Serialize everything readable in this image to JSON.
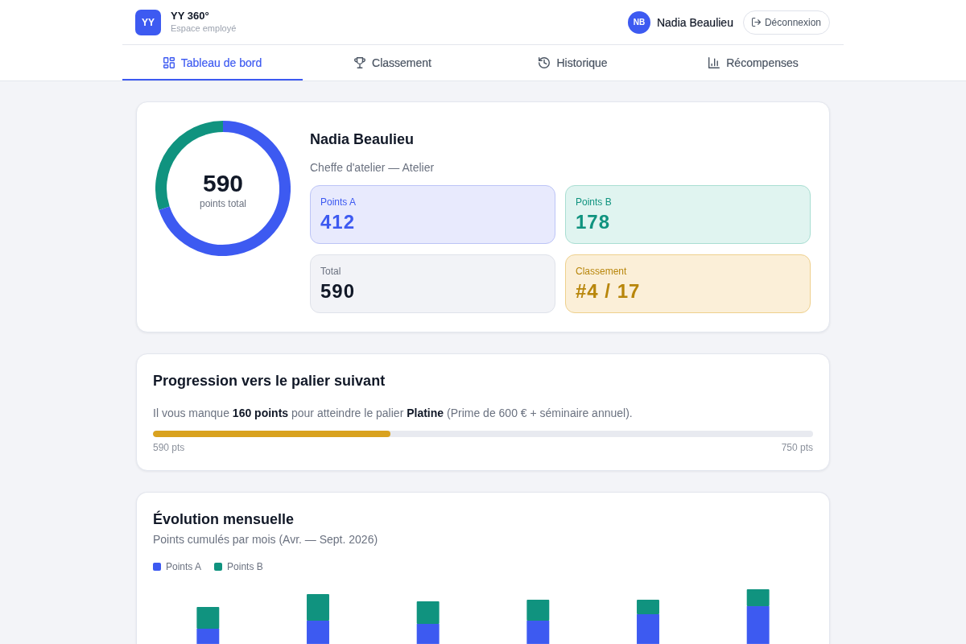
{
  "header": {
    "logo_text": "YY",
    "app_name": "YY 360°",
    "app_subtitle": "Espace employé",
    "user": {
      "initials": "NB",
      "name": "Nadia Beaulieu"
    },
    "logout_button": "Déconnexion"
  },
  "tabs": [
    {
      "label": "Tableau de bord",
      "selected": true
    },
    {
      "label": "Classement",
      "selected": false
    },
    {
      "label": "Historique",
      "selected": false
    },
    {
      "label": "Récompenses",
      "selected": false
    }
  ],
  "profile": {
    "donut": {
      "value": "590",
      "caption": "points total"
    },
    "name": "Nadia Beaulieu",
    "role": "Cheffe d'atelier — Atelier",
    "stats": [
      {
        "kind": "points_a",
        "label": "Points A",
        "value": "412"
      },
      {
        "kind": "points_b",
        "label": "Points B",
        "value": "178"
      },
      {
        "kind": "total",
        "label": "Total",
        "value": "590"
      },
      {
        "kind": "rank",
        "label": "Classement",
        "value": "#4 / 17"
      }
    ]
  },
  "progress": {
    "title": "Progression vers le palier suivant",
    "message": "Il vous manque **160 points** pour atteindre le palier **Platine** (Prime de 600 € + séminaire annuel).",
    "level": 0.36,
    "start_label": "590 pts",
    "end_label": "750 pts"
  },
  "monthly": {
    "title": "Évolution mensuelle",
    "subtitle": "Points cumulés par mois (Avr. — Sept. 2026)",
    "legend": [
      {
        "label": "Points A",
        "color": "#3d5af1"
      },
      {
        "label": "Points B",
        "color": "#10937f"
      }
    ]
  }
}
